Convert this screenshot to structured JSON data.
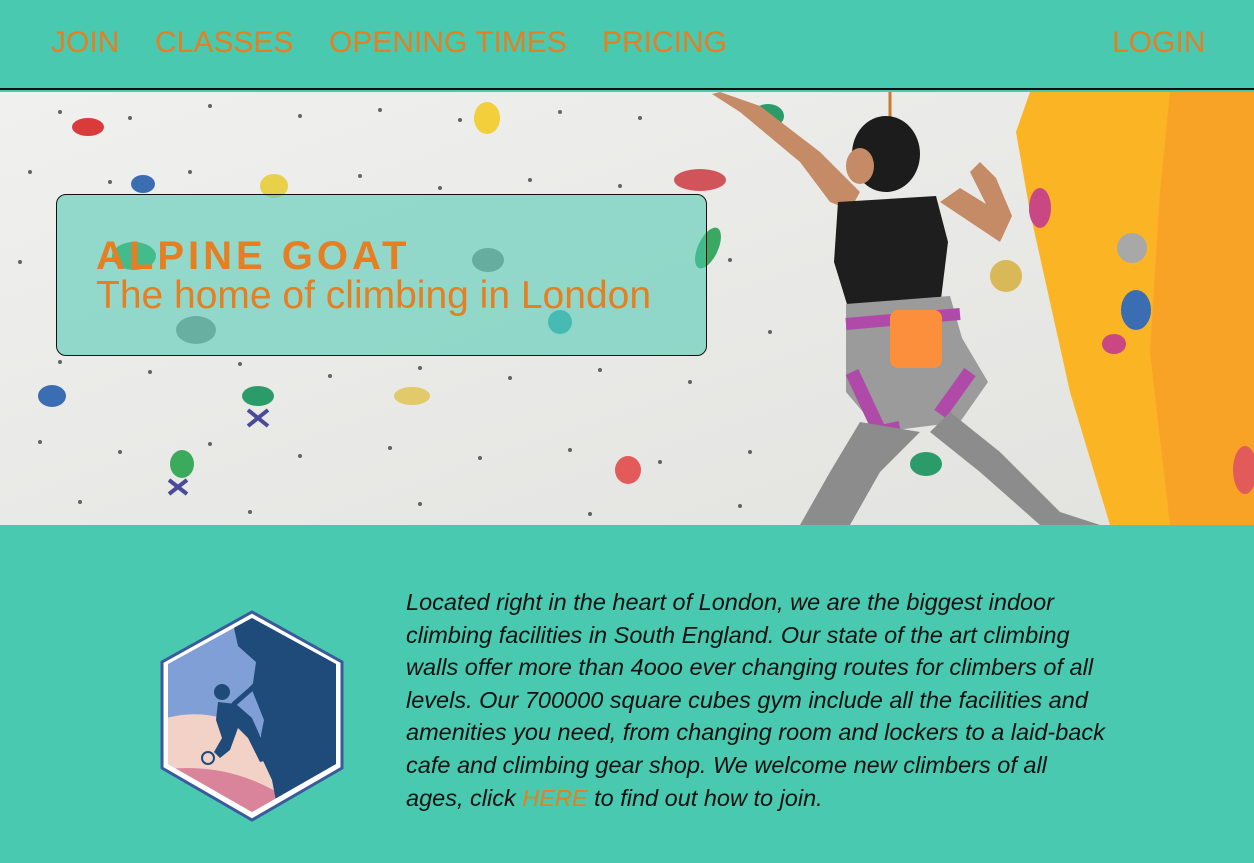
{
  "nav": {
    "items": [
      {
        "label": "JOIN"
      },
      {
        "label": "CLASSES"
      },
      {
        "label": "OPENING TIMES"
      },
      {
        "label": "PRICING"
      }
    ],
    "login": "LOGIN"
  },
  "hero": {
    "title": "ALPINE GOAT",
    "subtitle": "The home of climbing in London"
  },
  "about": {
    "text_before": "Located right in the heart of London, we are the biggest indoor climbing facilities in South England. Our state of the art climbing walls offer more than 4ooo ever changing routes for climbers of all levels. Our 700000 square cubes gym include all the facilities and amenities you need, from changing room and lockers to a laid-back cafe and climbing gear shop. We welcome new climbers of all ages, click ",
    "link": "HERE",
    "text_after": " to find out how to join."
  },
  "colors": {
    "background": "#48c9b0",
    "accent": "#e67e22",
    "text": "#111111"
  },
  "icons": [
    "climber-logo-icon"
  ]
}
